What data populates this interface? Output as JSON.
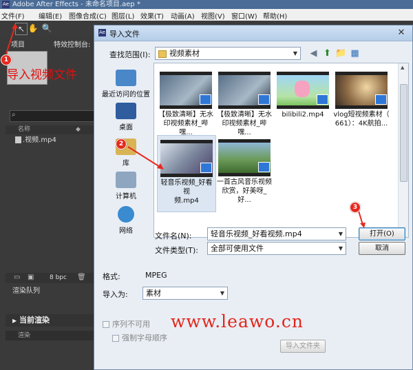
{
  "app": {
    "title": "Adobe After Effects - 未命名项目.aep *",
    "icon": "ae-icon",
    "menu": [
      "文件(F)",
      "编辑(E)",
      "图像合成(C)",
      "图层(L)",
      "效果(T)",
      "动画(A)",
      "视图(V)",
      "窗口(W)",
      "帮助(H)"
    ]
  },
  "project_panel": {
    "tab_project": "项目",
    "tab_effects": "特效控制台:",
    "annotation": "导入视频文件",
    "col_name": "名称",
    "file": ".视频.mp4",
    "bit_depth": "8 bpc",
    "render_queue_tab": "渲染队列",
    "current_render": "当前渲染",
    "render_col": "渲染"
  },
  "dialog": {
    "title": "导入文件",
    "look_in_label": "查找范围(I):",
    "look_in_value": "视频素材",
    "places": [
      {
        "label": "最近访问的位置",
        "icon": "recent-places-icon"
      },
      {
        "label": "桌面",
        "icon": "desktop-icon"
      },
      {
        "label": "库",
        "icon": "libraries-icon"
      },
      {
        "label": "计算机",
        "icon": "computer-icon"
      },
      {
        "label": "网络",
        "icon": "network-icon"
      }
    ],
    "files": [
      {
        "line1": "【极致清晰】无水",
        "line2": "印视频素材_哔嘿..."
      },
      {
        "line1": "【极致清晰】无水",
        "line2": "印视频素材_哔嘿..."
      },
      {
        "line1": "bilibili2.mp4",
        "line2": ""
      },
      {
        "line1": "vlog短视频素材（",
        "line2": "661）：4K航拍..."
      },
      {
        "line1": "轻音乐视频_好看视",
        "line2": "频.mp4"
      },
      {
        "line1": "一首古风音乐视频",
        "line2": "欣赏，好美呀_好..."
      }
    ],
    "filename_label": "文件名(N):",
    "filename_value": "轻音乐视频_好看视频.mp4",
    "filetype_label": "文件类型(T):",
    "filetype_value": "全部可使用文件",
    "open_button": "打开(O)",
    "cancel_button": "取消",
    "format_label": "格式:",
    "format_value": "MPEG",
    "import_as_label": "导入为:",
    "import_as_value": "素材",
    "sequence_label": "序列不可用",
    "force_alpha_label": "强制字母顺序",
    "import_folder_button": "导入文件夹"
  },
  "annotations": {
    "step1": "1",
    "step2": "2",
    "step3": "3",
    "watermark": "www.leawo.cn",
    "color": "#e52a1f"
  }
}
